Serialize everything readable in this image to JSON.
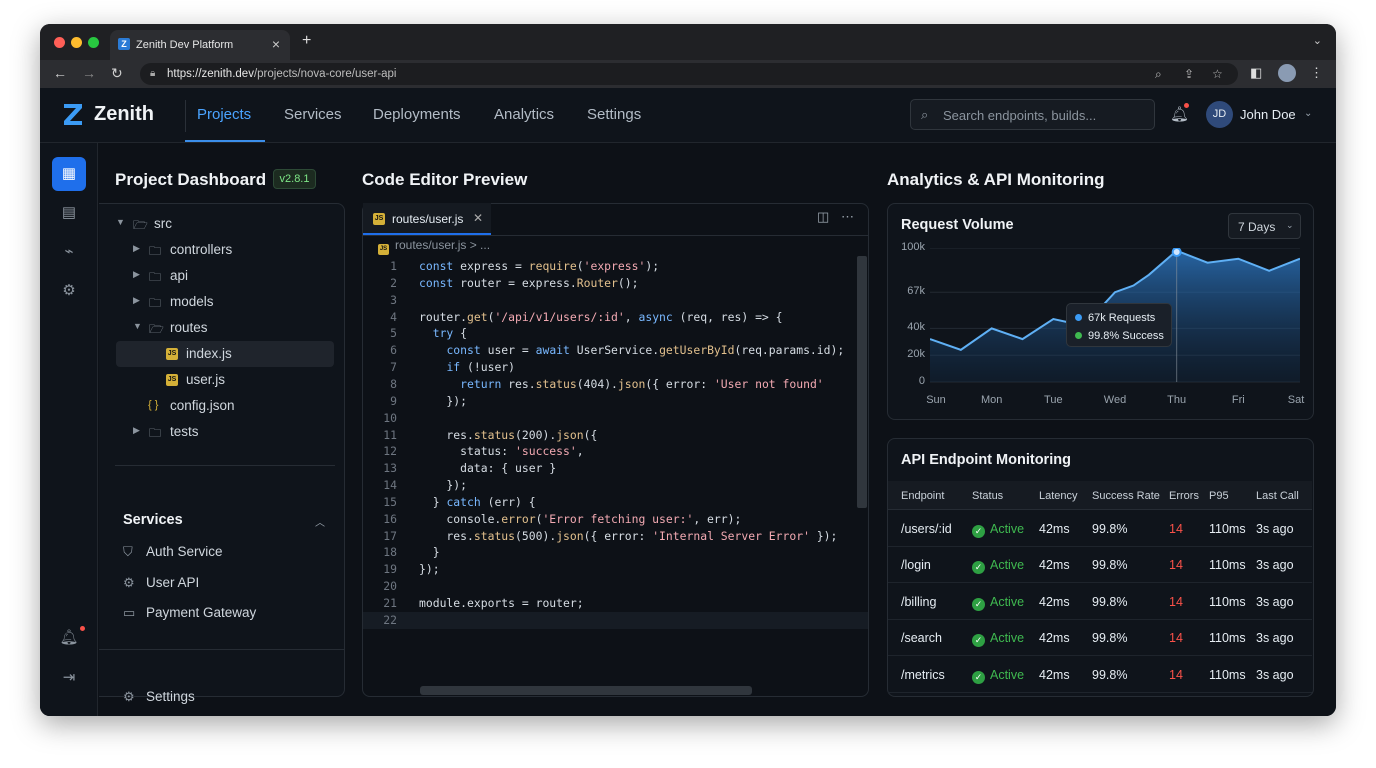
{
  "browser": {
    "tab_title": "Zenith Dev Platform",
    "url_host": "https://zenith.dev",
    "url_path": "/projects/nova-core/user-api"
  },
  "app": {
    "brand": "Zenith",
    "nav": [
      "Projects",
      "Services",
      "Deployments",
      "Analytics",
      "Settings"
    ],
    "active_nav": "Projects",
    "search_placeholder": "Search endpoints, builds...",
    "user_initials": "JD",
    "user_name": "John Doe"
  },
  "dashboard": {
    "title": "Project Dashboard",
    "version": "v2.8.1",
    "tree": [
      {
        "label": "src",
        "type": "folder",
        "open": true
      },
      {
        "label": "controllers",
        "type": "folder"
      },
      {
        "label": "api",
        "type": "folder"
      },
      {
        "label": "models",
        "type": "folder"
      },
      {
        "label": "routes",
        "type": "folder",
        "open": true
      },
      {
        "label": "index.js",
        "type": "js",
        "selected": true
      },
      {
        "label": "user.js",
        "type": "js"
      },
      {
        "label": "config.json",
        "type": "json"
      },
      {
        "label": "tests",
        "type": "folder"
      }
    ],
    "services_title": "Services",
    "services": [
      "Auth Service",
      "User API",
      "Payment Gateway"
    ],
    "settings_label": "Settings"
  },
  "editor": {
    "title": "Code Editor Preview",
    "tab_name": "routes/user.js",
    "breadcrumb": "routes/user.js > ...",
    "lines": [
      "const express = require('express');",
      "const router = express.Router();",
      "",
      "router.get('/api/v1/users/:id', async (req, res) => {",
      "  try {",
      "    const user = await UserService.getUserById(req.params.id);",
      "    if (!user)",
      "      return res.status(404).json({ error: 'User not found'",
      "    });",
      "",
      "    res.status(200).json({",
      "      status: 'success',",
      "      data: { user }",
      "    });",
      "  } catch (err) {",
      "    console.error('Error fetching user:', err);",
      "    res.status(500).json({ error: 'Internal Server Error' });",
      "  }",
      "});",
      "",
      "module.exports = router;",
      ""
    ],
    "current_line": 22
  },
  "analytics": {
    "title": "Analytics & API Monitoring",
    "request_volume_title": "Request Volume",
    "range": "7 Days",
    "tooltip_requests": "67k Requests",
    "tooltip_success": "99.8% Success",
    "colors": {
      "line": "#5fb0f5",
      "accent": "#1f6feb",
      "success": "#3fb950",
      "error": "#f85149"
    }
  },
  "chart_data": {
    "type": "area",
    "title": "Request Volume",
    "categories": [
      "Sun",
      "Mon",
      "Tue",
      "Wed",
      "Thu",
      "Fri",
      "Sat"
    ],
    "x_points": [
      0,
      0.5,
      1,
      1.5,
      2,
      2.5,
      3,
      3.3,
      3.55,
      4,
      4.5,
      5,
      5.5,
      6
    ],
    "values": [
      32,
      24,
      40,
      32,
      47,
      42,
      67,
      72,
      80,
      98,
      89,
      92,
      83,
      92
    ],
    "y_ticks": [
      "0",
      "20k",
      "40k",
      "67k",
      "100k"
    ],
    "ylim": [
      0,
      100
    ],
    "highlight_category": "Thu",
    "grid": true
  },
  "monitoring": {
    "title": "API Endpoint Monitoring",
    "columns": [
      "Endpoint",
      "Status",
      "Latency",
      "Success Rate",
      "Errors",
      "P95",
      "Last Call"
    ],
    "rows": [
      [
        "/users/:id",
        "Active",
        "42ms",
        "99.8%",
        "14",
        "110ms",
        "3s ago"
      ],
      [
        "/login",
        "Active",
        "42ms",
        "99.8%",
        "14",
        "110ms",
        "3s ago"
      ],
      [
        "/billing",
        "Active",
        "42ms",
        "99.8%",
        "14",
        "110ms",
        "3s ago"
      ],
      [
        "/search",
        "Active",
        "42ms",
        "99.8%",
        "14",
        "110ms",
        "3s ago"
      ],
      [
        "/metrics",
        "Active",
        "42ms",
        "99.8%",
        "14",
        "110ms",
        "3s ago"
      ]
    ]
  }
}
